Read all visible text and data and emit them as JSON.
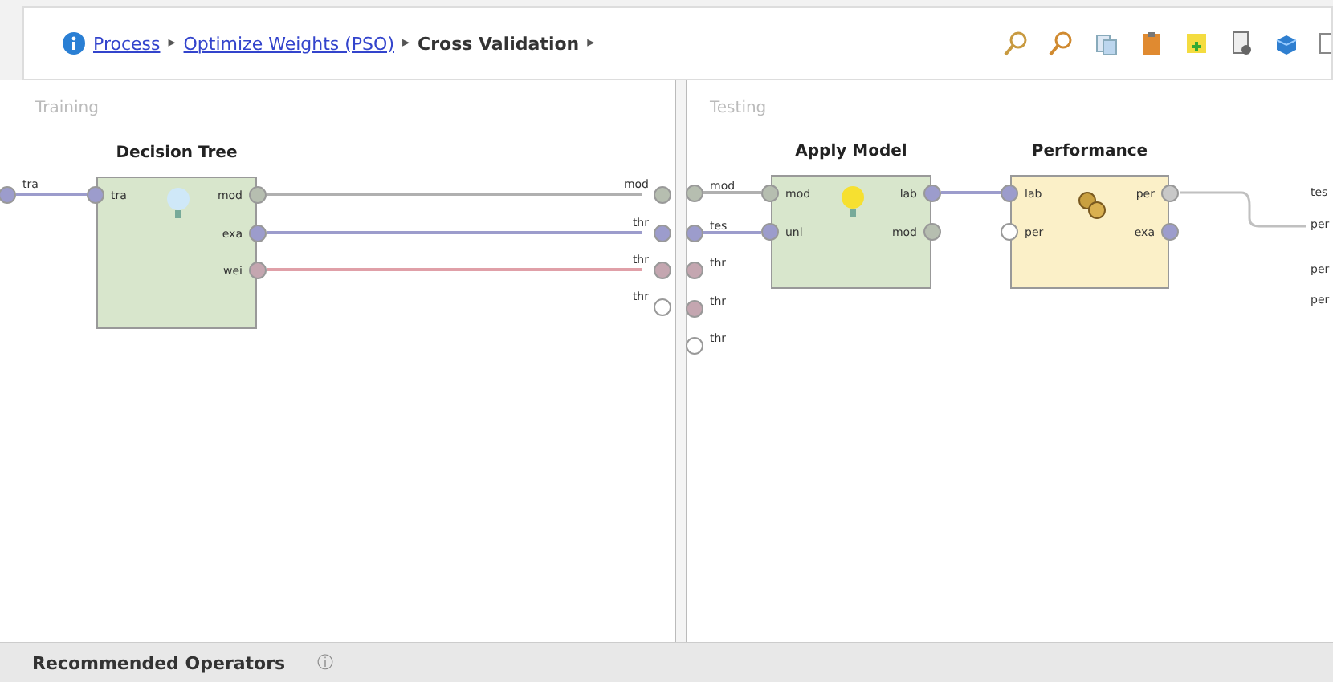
{
  "breadcrumb": {
    "separator": "▸",
    "items": [
      {
        "label": "Process",
        "kind": "link"
      },
      {
        "label": "Optimize Weights (PSO)",
        "kind": "link"
      },
      {
        "label": "Cross Validation",
        "kind": "current"
      }
    ]
  },
  "panels": [
    {
      "title": "Training",
      "inputs": [
        {
          "label": "tra",
          "color": "#9c9ccc"
        }
      ],
      "outputs": [
        {
          "label": "mod",
          "color": "#b6beb0"
        },
        {
          "label": "thr",
          "color": "#9c9ccc"
        },
        {
          "label": "thr",
          "color": "#c4a6b0"
        },
        {
          "label": "thr",
          "color": "#ffffff"
        }
      ],
      "operators": [
        {
          "name": "Decision Tree",
          "kind": "learner",
          "inputs": [
            {
              "label": "tra",
              "color": "#9c9ccc"
            }
          ],
          "outputs": [
            {
              "label": "mod",
              "color": "#b6beb0"
            },
            {
              "label": "exa",
              "color": "#9c9ccc"
            },
            {
              "label": "wei",
              "color": "#c4a6b0"
            }
          ]
        }
      ],
      "wires": [
        {
          "color": "#9c9ccc"
        },
        {
          "color": "#b0b0b0"
        },
        {
          "color": "#9c9ccc"
        },
        {
          "color": "#e0a0a8"
        }
      ]
    },
    {
      "title": "Testing",
      "inputs": [
        {
          "label": "mod",
          "color": "#b6beb0"
        },
        {
          "label": "tes",
          "color": "#9c9ccc"
        },
        {
          "label": "thr",
          "color": "#c4a6b0"
        },
        {
          "label": "thr",
          "color": "#c4a6b0"
        },
        {
          "label": "thr",
          "color": "#ffffff"
        }
      ],
      "outputs": [
        {
          "label": "tes"
        },
        {
          "label": "per"
        },
        {
          "label": "per"
        },
        {
          "label": "per"
        }
      ],
      "operators": [
        {
          "name": "Apply Model",
          "kind": "applier",
          "inputs": [
            {
              "label": "mod",
              "color": "#b6beb0"
            },
            {
              "label": "unl",
              "color": "#9c9ccc"
            }
          ],
          "outputs": [
            {
              "label": "lab",
              "color": "#9c9ccc"
            },
            {
              "label": "mod",
              "color": "#b6beb0"
            }
          ]
        },
        {
          "name": "Performance",
          "kind": "evaluator",
          "inputs": [
            {
              "label": "lab",
              "color": "#9c9ccc"
            },
            {
              "label": "per",
              "color": "#ffffff"
            }
          ],
          "outputs": [
            {
              "label": "per",
              "color": "#c8c8c8"
            },
            {
              "label": "exa",
              "color": "#9c9ccc"
            }
          ]
        }
      ],
      "wires": [
        {
          "color": "#b0b0b0"
        },
        {
          "color": "#9c9ccc"
        },
        {
          "color": "#9c9ccc"
        },
        {
          "color": "#c0c0c0"
        }
      ]
    }
  ],
  "bottom_bar": {
    "title": "Recommended Operators",
    "info": "ⓘ"
  }
}
